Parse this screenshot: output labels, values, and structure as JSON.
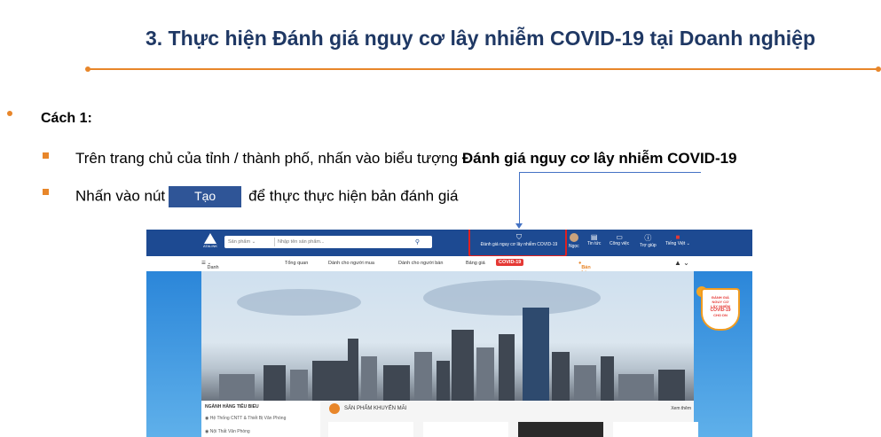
{
  "title": "3. Thực hiện Đánh giá nguy cơ lây nhiễm COVID-19 tại Doanh nghiệp",
  "section_label": "Cách 1:",
  "step1": {
    "prefix": "Trên trang chủ của tỉnh / thành phố, nhấn vào biểu tượng ",
    "bold": "Đánh giá nguy cơ lây nhiễm COVID-19"
  },
  "step2": {
    "prefix": "Nhấn vào nút",
    "button": "Tạo",
    "suffix": "để thực thực hiện bản đánh giá"
  },
  "colors": {
    "accent": "#e8862a",
    "title": "#1f3864",
    "button": "#2f5597",
    "site_blue": "#1d4a92",
    "highlight": "#e02020"
  },
  "screenshot": {
    "logo": "ATALINK",
    "search_category": "Sản phẩm",
    "search_placeholder": "Nhập tên sản phẩm...",
    "covid_link": "Đánh giá nguy cơ lây nhiễm COVID-19",
    "user": "Ngọc",
    "nav": [
      "Tin tức",
      "Công việc",
      "Trợ giúp",
      "Tiếng Việt"
    ],
    "menu": [
      "Danh mục ngành hàng",
      "Tổng quan",
      "Dành cho người mua",
      "Dành cho người bán",
      "Bảng giá",
      "COVID-19"
    ],
    "sell": "Bán hàng ngay",
    "badge": [
      "ĐÁNH GIÁ",
      "NGUY CƠ",
      "LÂY NHIỄM",
      "COVID-19",
      "CHO DN"
    ],
    "cat_header": "NGÀNH HÀNG TIÊU BIỂU",
    "cat_items": [
      "Hệ Thống CNTT & Thiết Bị Văn Phòng",
      "Nội Thất Văn Phòng"
    ],
    "promo_title": "SẢN PHẨM KHUYẾN MÃI",
    "see_all": "Xem thêm"
  }
}
